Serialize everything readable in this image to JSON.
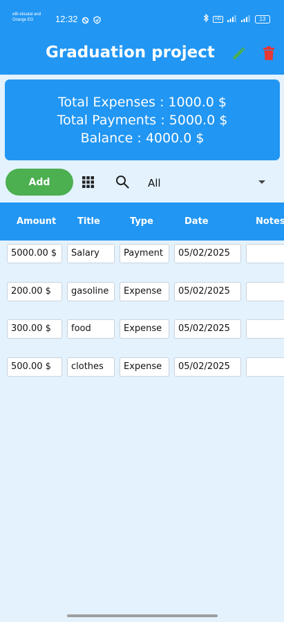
{
  "status_bar": {
    "carrier_line1": "eBi etisalat and",
    "carrier_line2": "Orange EG",
    "time": "12:32",
    "network_badge": "HD",
    "battery": "13"
  },
  "app_bar": {
    "title": "Graduation project",
    "edit_icon": "pencil-icon",
    "delete_icon": "trash-icon",
    "edit_color": "#4caf50",
    "delete_color": "#e53935"
  },
  "summary": {
    "total_expenses": "Total Expenses : 1000.0 $",
    "total_payments": "Total Payments : 5000.0 $",
    "balance": "Balance : 4000.0 $"
  },
  "toolbar": {
    "add_label": "Add",
    "filter_value": "All",
    "grid_icon": "grid-icon",
    "search_icon": "search-icon"
  },
  "table": {
    "headers": [
      "Amount",
      "Title",
      "Type",
      "Date",
      "Notes"
    ],
    "rows": [
      {
        "amount": "5000.00 $",
        "title": "Salary",
        "type": "Payment",
        "date": "05/02/2025",
        "notes": ""
      },
      {
        "amount": "200.00 $",
        "title": "gasoline",
        "type": "Expense",
        "date": "05/02/2025",
        "notes": ""
      },
      {
        "amount": "300.00 $",
        "title": "food",
        "type": "Expense",
        "date": "05/02/2025",
        "notes": ""
      },
      {
        "amount": "500.00 $",
        "title": "clothes",
        "type": "Expense",
        "date": "05/02/2025",
        "notes": ""
      }
    ]
  },
  "colors": {
    "primary": "#2196f3",
    "background": "#e3f2fd",
    "add_button": "#4caf50"
  }
}
